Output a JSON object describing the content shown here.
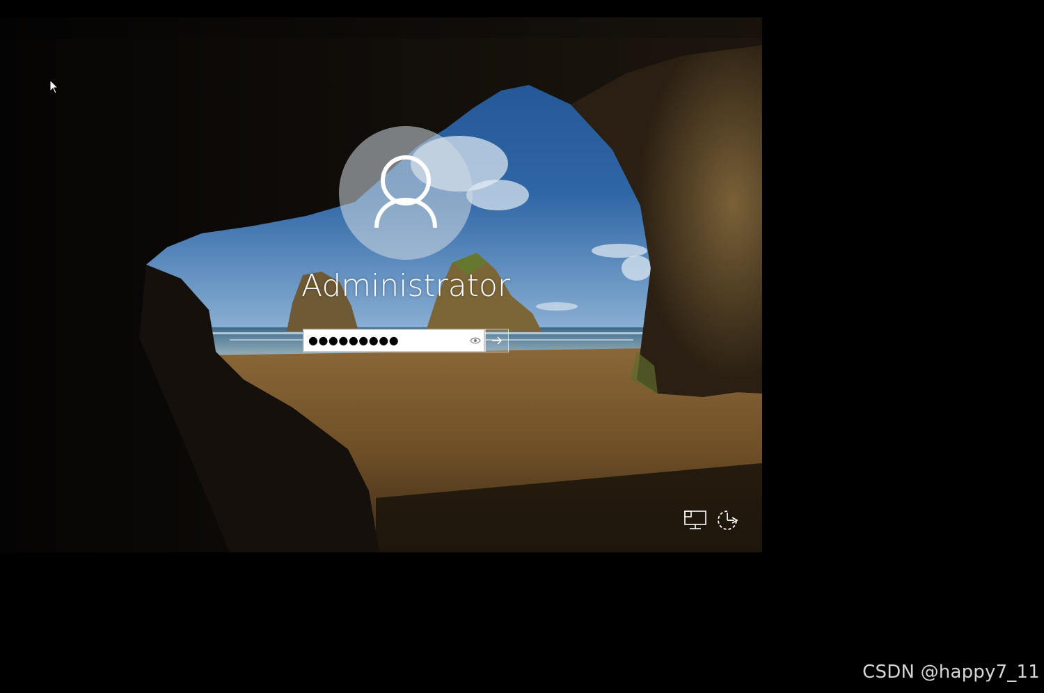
{
  "lock_screen": {
    "username": "Administrator",
    "password_value": "●●●●●●●●●",
    "icons": {
      "avatar": "user-silhouette-icon",
      "reveal": "eye-icon",
      "submit": "arrow-right-icon",
      "network": "network-icon",
      "ease_of_access": "ease-of-access-icon"
    }
  },
  "cursor": {
    "icon": "mouse-pointer-icon"
  },
  "watermark": {
    "text": "CSDN @happy7_11"
  }
}
